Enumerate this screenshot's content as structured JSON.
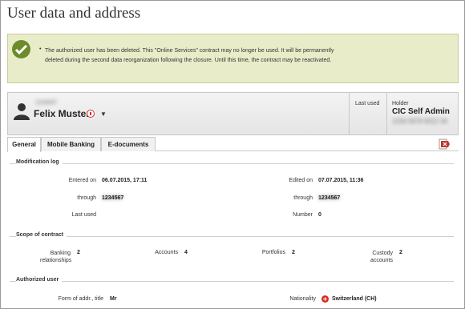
{
  "page": {
    "title": "User data and address"
  },
  "notice": {
    "icon": "check-circle-icon",
    "message": "The authorized user has been deleted. This \"Online Services\" contract may no longer be used. It will be permanently deleted during the second data reorganization following the closure. Until this time, the contract may be reactivated."
  },
  "user": {
    "id": "1234567",
    "name": "Felix Muster",
    "last_used_label": "Last used",
    "holder_label": "Holder",
    "holder_name": "CIC Self Admin",
    "holder_id": "1234 5678 9012 34"
  },
  "tabs": [
    "General",
    "Mobile Banking",
    "E-documents"
  ],
  "modification_log": {
    "title": "Modification log",
    "entered_on_label": "Entered on",
    "entered_on": "06.07.2015, 17:11",
    "edited_on_label": "Edited on",
    "edited_on": "07.07.2015, 11:36",
    "through_label": "through",
    "through_left": "1234567",
    "through_right": "1234567",
    "last_used_label": "Last used",
    "number_label": "Number",
    "number": "0"
  },
  "scope": {
    "title": "Scope of contract",
    "banking_label": "Banking relationships",
    "banking": "2",
    "accounts_label": "Accounts",
    "accounts": "4",
    "portfolios_label": "Portfolios",
    "portfolios": "2",
    "custody_label": "Custody accounts",
    "custody": "2"
  },
  "authorized_user": {
    "title": "Authorized user",
    "form_label": "Form of addr., title",
    "form": "Mr",
    "nationality_label": "Nationality",
    "nationality": "Switzerland (CH)"
  },
  "colors": {
    "notice_bg": "#e9ecc9",
    "check": "#6d8b2a",
    "pdf_red": "#c0392b"
  }
}
